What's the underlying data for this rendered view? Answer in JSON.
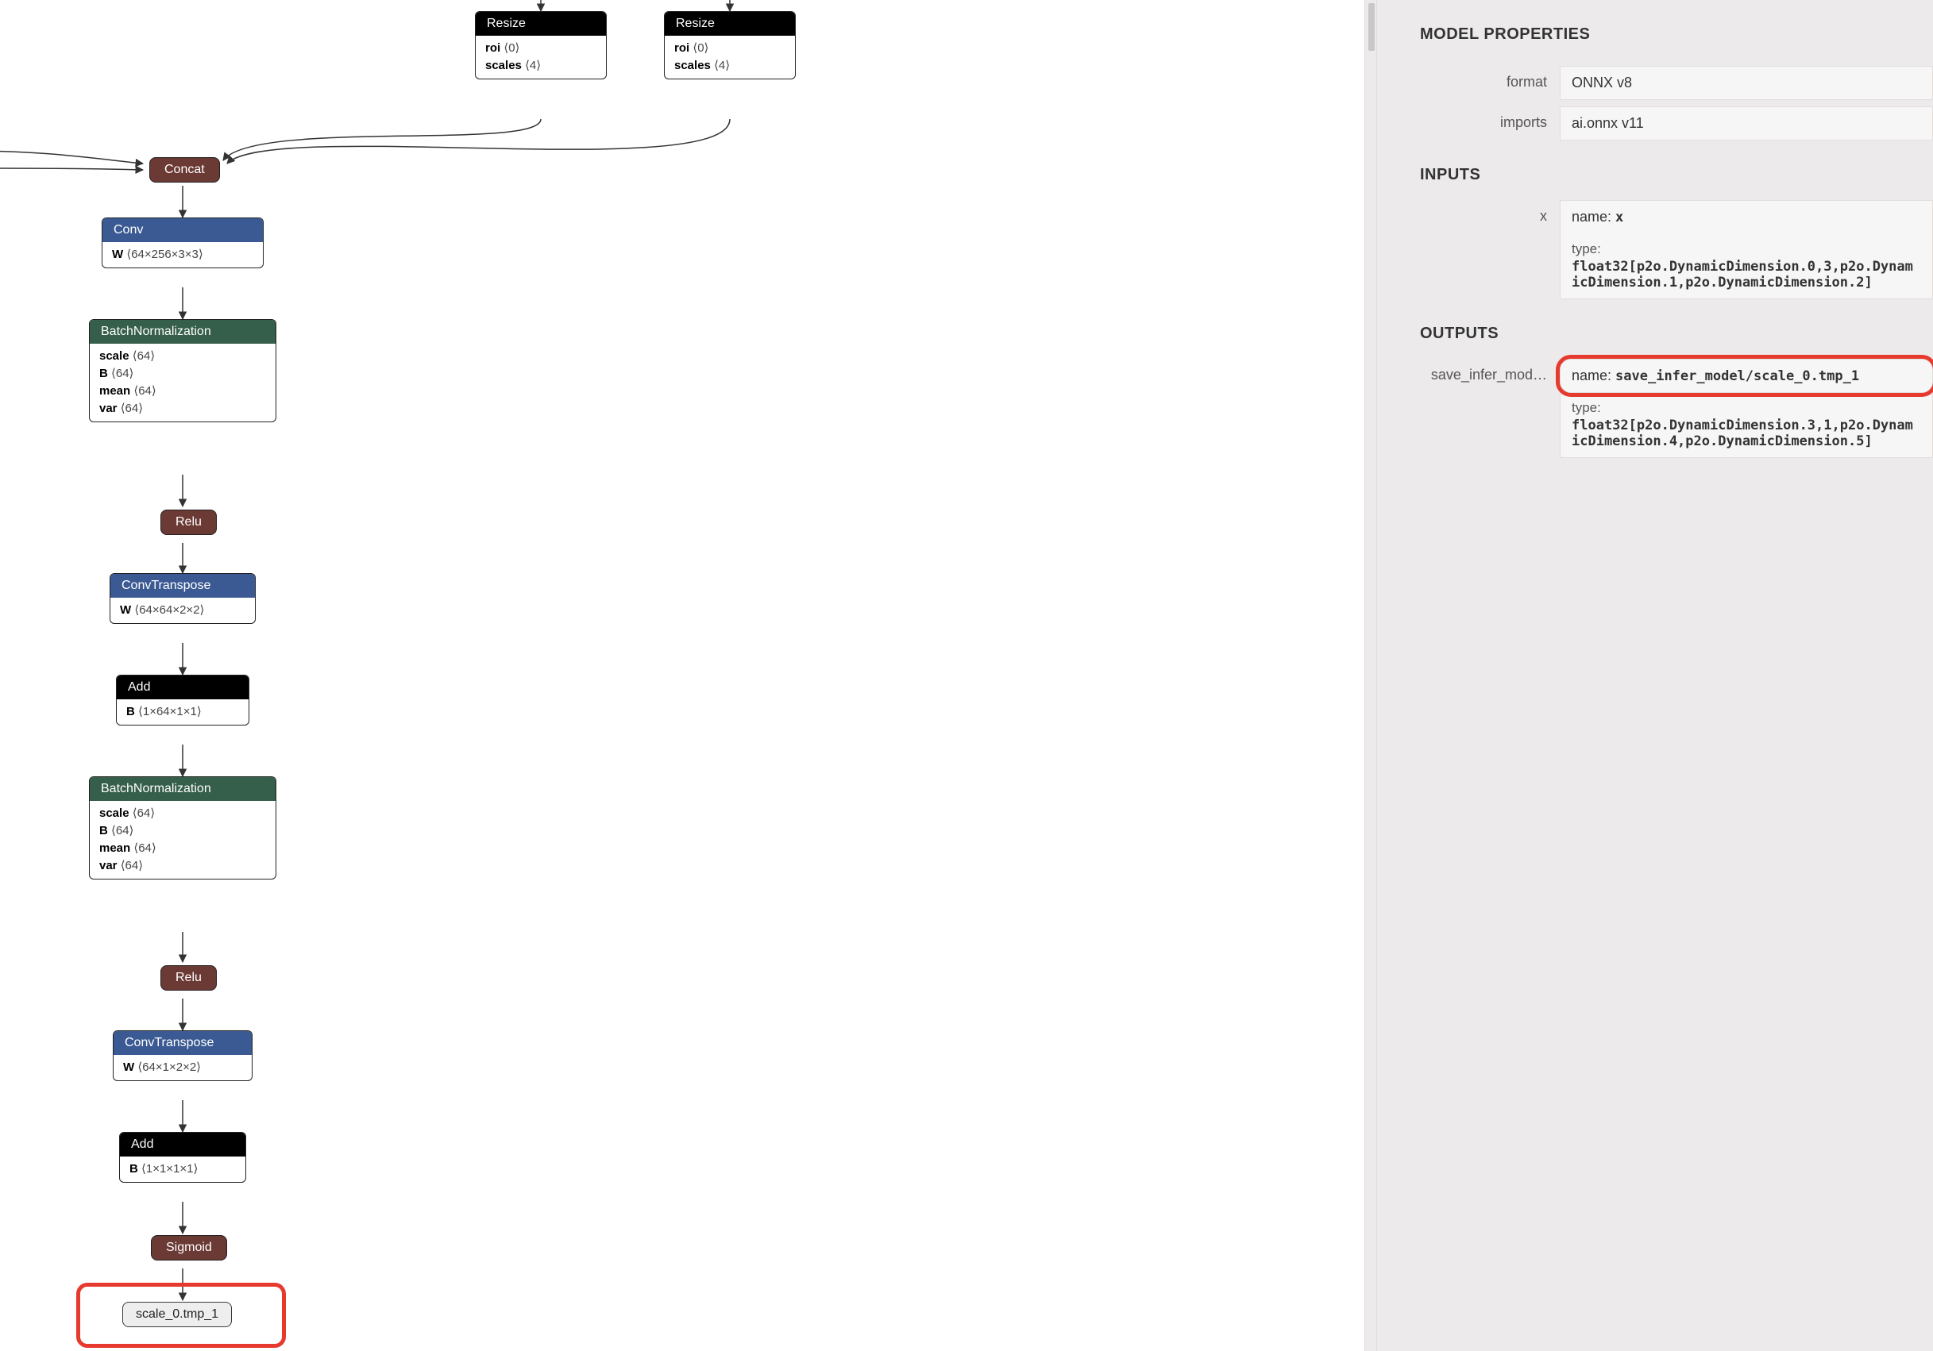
{
  "sidebar": {
    "title_props": "MODEL PROPERTIES",
    "title_inputs": "INPUTS",
    "title_outputs": "OUTPUTS",
    "props": {
      "format_key": "format",
      "format_val": "ONNX v8",
      "imports_key": "imports",
      "imports_val": "ai.onnx v11"
    },
    "inputs": {
      "row_key": "x",
      "name_label": "name: ",
      "name_val": "x",
      "type_label": "type:",
      "type_val": "float32[p2o.DynamicDimension.0,3,p2o.DynamicDimension.1,p2o.DynamicDimension.2]"
    },
    "outputs": {
      "row_key": "save_infer_mod…",
      "name_label": "name: ",
      "name_val": "save_infer_model/scale_0.tmp_1",
      "type_label": "type:",
      "type_val": "float32[p2o.DynamicDimension.3,1,p2o.DynamicDimension.4,p2o.DynamicDimension.5]"
    }
  },
  "graph": {
    "resize1": {
      "title": "Resize",
      "roi": "roi  ⟨0⟩",
      "scales": "scales  ⟨4⟩"
    },
    "resize2": {
      "title": "Resize",
      "roi": "roi  ⟨0⟩",
      "scales": "scales  ⟨4⟩"
    },
    "concat": "Concat",
    "conv1": {
      "title": "Conv",
      "w": "W  ⟨64×256×3×3⟩"
    },
    "bn1": {
      "title": "BatchNormalization",
      "scale": "scale  ⟨64⟩",
      "B": "B  ⟨64⟩",
      "mean": "mean  ⟨64⟩",
      "var": "var  ⟨64⟩"
    },
    "relu1": "Relu",
    "convT1": {
      "title": "ConvTranspose",
      "w": "W  ⟨64×64×2×2⟩"
    },
    "add1": {
      "title": "Add",
      "b": "B  ⟨1×64×1×1⟩"
    },
    "bn2": {
      "title": "BatchNormalization",
      "scale": "scale  ⟨64⟩",
      "B": "B  ⟨64⟩",
      "mean": "mean  ⟨64⟩",
      "var": "var  ⟨64⟩"
    },
    "relu2": "Relu",
    "convT2": {
      "title": "ConvTranspose",
      "w": "W  ⟨64×1×2×2⟩"
    },
    "add2": {
      "title": "Add",
      "b": "B  ⟨1×1×1×1⟩"
    },
    "sigmoid": "Sigmoid",
    "outname": "scale_0.tmp_1"
  }
}
